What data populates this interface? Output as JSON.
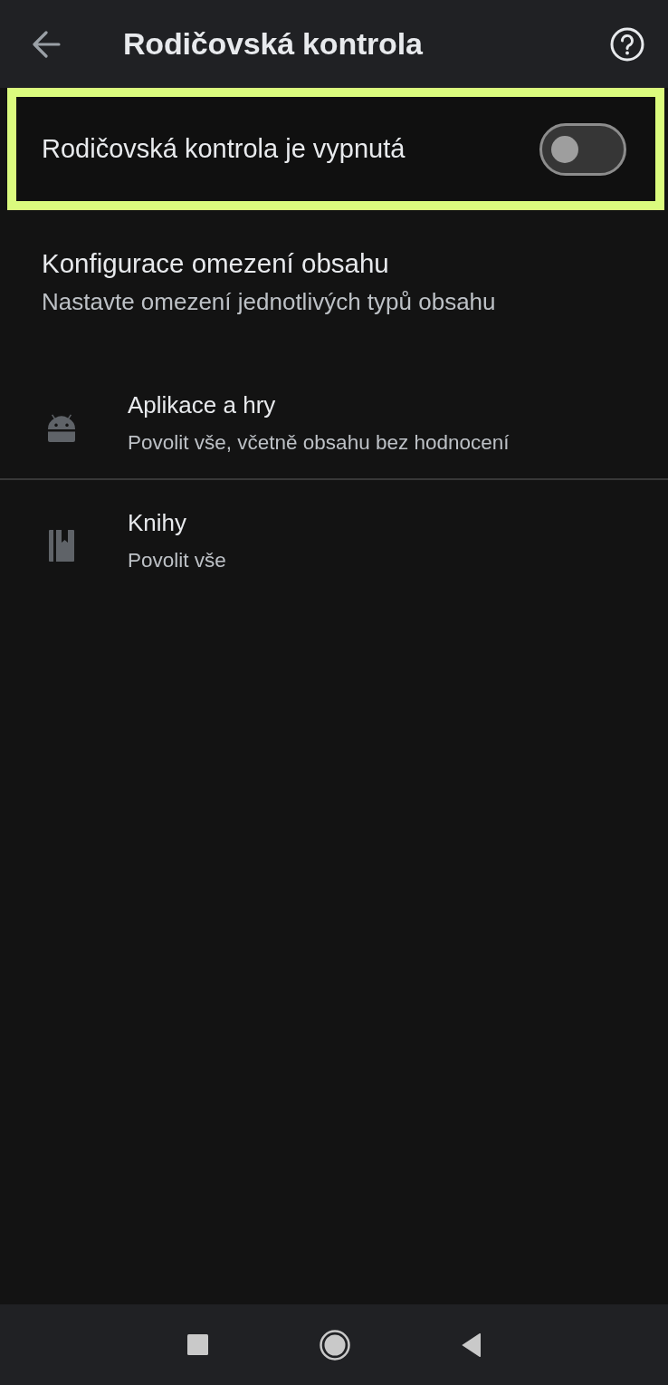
{
  "app_bar": {
    "title": "Rodičovská kontrola"
  },
  "master_switch": {
    "label": "Rodičovská kontrola je vypnutá",
    "on": false,
    "highlighted": true
  },
  "section": {
    "title": "Konfigurace omezení obsahu",
    "subtitle": "Nastavte omezení jednotlivých typů obsahu"
  },
  "items": [
    {
      "kind": "apps",
      "title": "Aplikace a hry",
      "subtitle": "Povolit vše, včetně obsahu bez hodnocení"
    },
    {
      "kind": "books",
      "title": "Knihy",
      "subtitle": "Povolit vše"
    }
  ]
}
